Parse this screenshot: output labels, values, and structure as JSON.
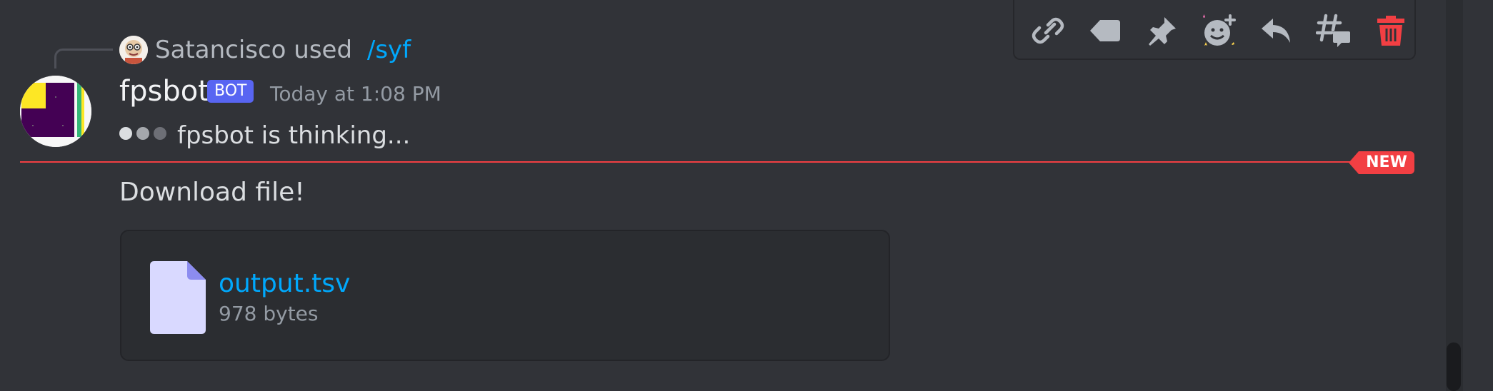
{
  "command_reply": {
    "user": "Satancisco",
    "action": "used",
    "command": "/syf"
  },
  "message": {
    "author": "fpsbot",
    "badge": "BOT",
    "timestamp": "Today at 1:08 PM",
    "thinking_text": "fpsbot is thinking...",
    "content": "Download file!"
  },
  "divider": {
    "label": "NEW"
  },
  "attachment": {
    "filename": "output.tsv",
    "size": "978 bytes"
  },
  "toolbar": {
    "buttons": [
      "link-icon",
      "tag-icon",
      "pin-icon",
      "add-reaction-icon",
      "reply-icon",
      "create-thread-icon",
      "delete-icon"
    ]
  },
  "colors": {
    "background": "#313338",
    "accent_link": "#00a8fc",
    "bot_badge": "#5865f2",
    "new_red": "#f23f43",
    "delete_red": "#f23f43"
  }
}
